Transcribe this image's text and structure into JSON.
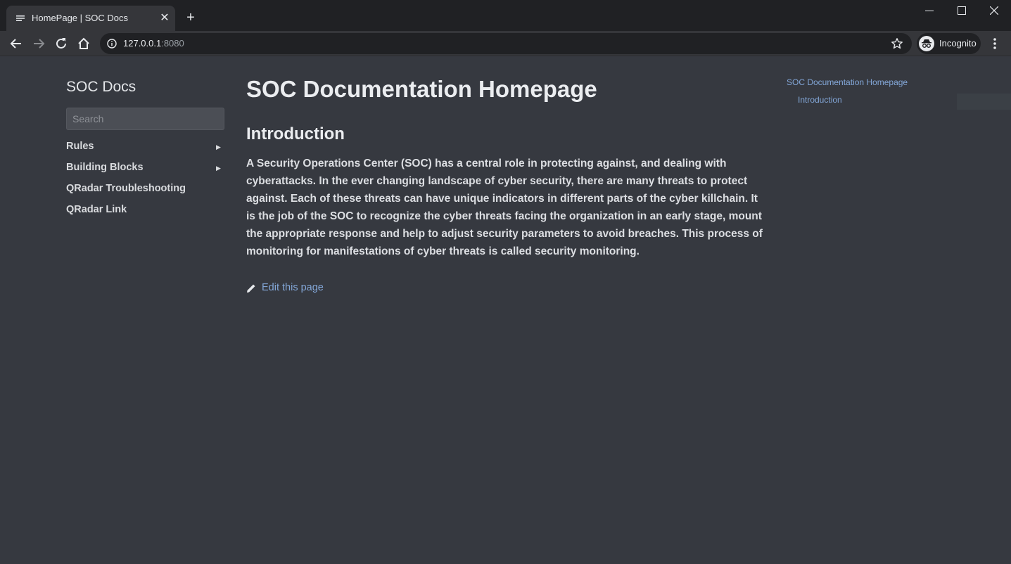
{
  "browser": {
    "tab_title": "HomePage | SOC Docs",
    "url_host": "127.0.0.1",
    "url_port": ":8080",
    "profile_label": "Incognito"
  },
  "sidebar": {
    "title": "SOC Docs",
    "search_placeholder": "Search",
    "items": [
      {
        "label": "Rules",
        "expandable": true
      },
      {
        "label": "Building Blocks",
        "expandable": true
      },
      {
        "label": "QRadar Troubleshooting",
        "expandable": false
      },
      {
        "label": "QRadar Link",
        "expandable": false
      }
    ]
  },
  "main": {
    "title": "SOC Documentation Homepage",
    "section_heading": "Introduction",
    "paragraph": "A Security Operations Center (SOC) has a central role in protecting against, and dealing with cyberattacks. In the ever changing landscape of cyber security, there are many threats to protect against. Each of these threats can have unique indicators in different parts of the cyber killchain. It is the job of the SOC to recognize the cyber threats facing the organization in an early stage, mount the appropriate response and help to adjust security parameters to avoid breaches. This process of monitoring for manifestations of cyber threats is called security monitoring.",
    "edit_link": "Edit this page"
  },
  "toc": {
    "items": [
      "SOC Documentation Homepage",
      "Introduction"
    ]
  },
  "colors": {
    "page_bg": "#363940",
    "link": "#83a7d8",
    "chrome_bg": "#202124"
  }
}
